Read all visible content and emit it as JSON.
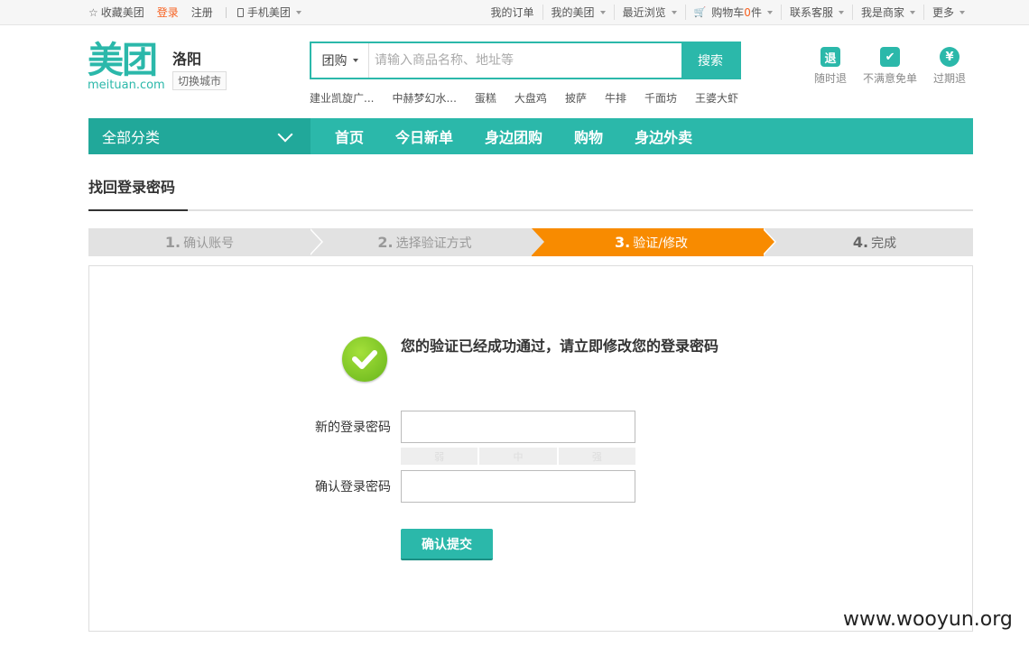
{
  "topbar": {
    "favorite": "收藏美团",
    "login": "登录",
    "register": "注册",
    "mobile": "手机美团",
    "right": [
      "我的订单",
      "我的美团",
      "最近浏览",
      "购物车",
      "联系客服",
      "我是商家",
      "更多"
    ],
    "cart_count": "0",
    "cart_unit": "件"
  },
  "header": {
    "logo_cn": "美团",
    "logo_en": "meituan.com",
    "city": "洛阳",
    "switch_city": "切换城市",
    "search_type": "团购",
    "search_placeholder": "请输入商品名称、地址等",
    "search_button": "搜索",
    "hot_words": [
      "建业凯旋广...",
      "中赫梦幻水...",
      "蛋糕",
      "大盘鸡",
      "披萨",
      "牛排",
      "千面坊",
      "王婆大虾"
    ],
    "guarantees": [
      {
        "icon": "退",
        "label": "随时退"
      },
      {
        "icon": "✔",
        "label": "不满意免单"
      },
      {
        "icon": "¥",
        "label": "过期退"
      }
    ]
  },
  "nav": {
    "category": "全部分类",
    "links": [
      "首页",
      "今日新单",
      "身边团购",
      "购物",
      "身边外卖"
    ]
  },
  "page": {
    "title": "找回登录密码",
    "steps": [
      {
        "num": "1.",
        "label": "确认账号"
      },
      {
        "num": "2.",
        "label": "选择验证方式"
      },
      {
        "num": "3.",
        "label": "验证/修改"
      },
      {
        "num": "4.",
        "label": "完成"
      }
    ],
    "active_step": 3,
    "success_message": "您的验证已经成功通过，请立即修改您的登录密码",
    "new_password_label": "新的登录密码",
    "confirm_password_label": "确认登录密码",
    "strength": [
      "弱",
      "中",
      "强"
    ],
    "submit": "确认提交"
  },
  "watermark": "www.wooyun.org",
  "colors": {
    "brand": "#2bb8aa",
    "accent": "#f88b00",
    "login": "#f76120"
  }
}
